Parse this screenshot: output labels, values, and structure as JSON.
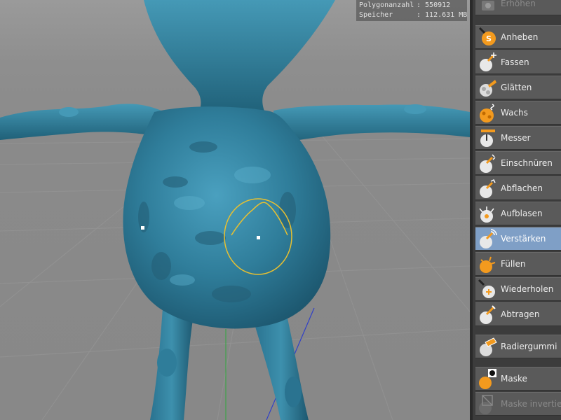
{
  "stats": {
    "polygon_label": "Polygonanzahl",
    "polygon_value": ": 550912",
    "memory_label": "Speicher",
    "memory_value": ": 112.631 MB"
  },
  "tools": [
    {
      "name": "erhoehen",
      "label": "Erhöhen",
      "icon": "increase-icon",
      "state": "disabled"
    },
    {
      "name": "anheben",
      "label": "Anheben",
      "icon": "pull-icon"
    },
    {
      "name": "fassen",
      "label": "Fassen",
      "icon": "grab-icon"
    },
    {
      "name": "glaetten",
      "label": "Glätten",
      "icon": "smooth-icon"
    },
    {
      "name": "wachs",
      "label": "Wachs",
      "icon": "wax-icon"
    },
    {
      "name": "messer",
      "label": "Messer",
      "icon": "knife-icon"
    },
    {
      "name": "einschnueren",
      "label": "Einschnüren",
      "icon": "pinch-icon"
    },
    {
      "name": "abflachen",
      "label": "Abflachen",
      "icon": "flatten-icon"
    },
    {
      "name": "aufblasen",
      "label": "Aufblasen",
      "icon": "inflate-icon"
    },
    {
      "name": "verstaerken",
      "label": "Verstärken",
      "icon": "amplify-icon",
      "state": "active"
    },
    {
      "name": "fuellen",
      "label": "Füllen",
      "icon": "fill-icon"
    },
    {
      "name": "wiederholen",
      "label": "Wiederholen",
      "icon": "repeat-icon"
    },
    {
      "name": "abtragen",
      "label": "Abtragen",
      "icon": "scrape-icon"
    },
    {
      "name": "radiergummi",
      "label": "Radiergummi",
      "icon": "eraser-icon"
    },
    {
      "name": "maske",
      "label": "Maske",
      "icon": "mask-icon"
    },
    {
      "name": "maske-invertieren",
      "label": "Maske invertieren",
      "icon": "invert-mask-icon",
      "state": "disabled"
    }
  ],
  "colors": {
    "model": "#2f7d9a",
    "brush_ring": "#e8c030",
    "active_tool": "#7f9fc6",
    "icon_orange": "#f39a1e"
  }
}
